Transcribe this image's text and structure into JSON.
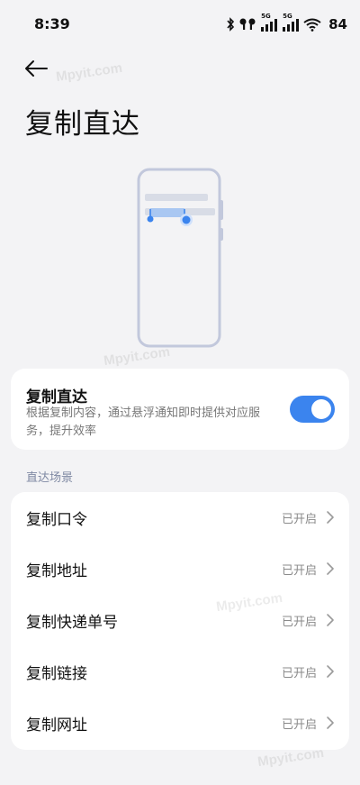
{
  "status_bar": {
    "time": "8:39",
    "battery": "84",
    "network_5g_1": "5G",
    "network_5g_2": "5G",
    "icons": [
      "bluetooth-icon",
      "earbuds-icon",
      "signal-icon",
      "signal-icon",
      "wifi-icon"
    ]
  },
  "header": {
    "back_icon": "back-arrow-icon",
    "title": "复制直达"
  },
  "main_setting": {
    "title": "复制直达",
    "description": "根据复制内容，通过悬浮通知即时提供对应服务，提升效率",
    "enabled": true,
    "accent_color": "#3b84ee"
  },
  "section": {
    "label": "直达场景"
  },
  "scenes": [
    {
      "label": "复制口令",
      "status": "已开启"
    },
    {
      "label": "复制地址",
      "status": "已开启"
    },
    {
      "label": "复制快递单号",
      "status": "已开启"
    },
    {
      "label": "复制链接",
      "status": "已开启"
    },
    {
      "label": "复制网址",
      "status": "已开启"
    }
  ],
  "watermark_text": "Mpyit.com"
}
